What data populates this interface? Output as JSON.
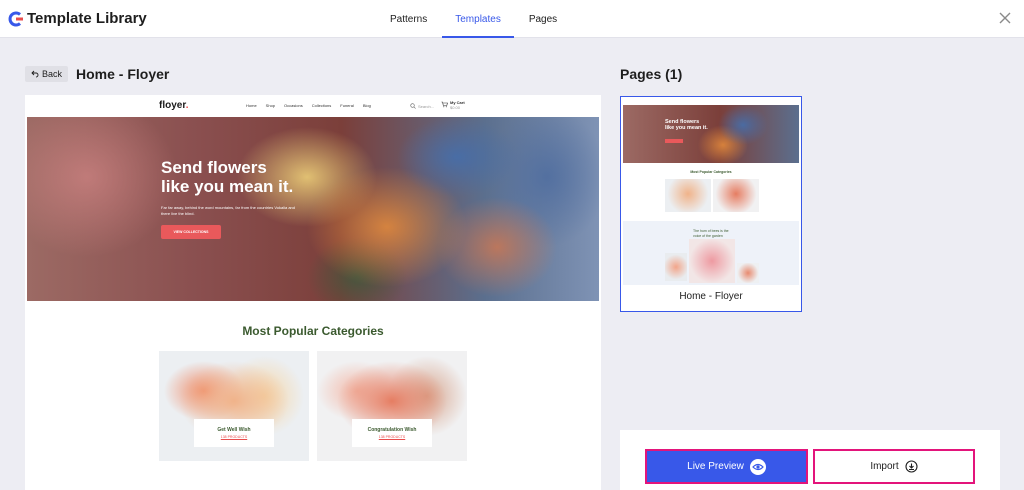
{
  "app": {
    "title": "Template Library"
  },
  "tabs": [
    {
      "label": "Patterns",
      "active": false
    },
    {
      "label": "Templates",
      "active": true
    },
    {
      "label": "Pages",
      "active": false
    }
  ],
  "header": {
    "back_label": "Back",
    "template_title": "Home - Floyer"
  },
  "preview": {
    "site_logo": "floyer",
    "site_logo_dot": ".",
    "menu": [
      "Home",
      "Shop",
      "Occasions",
      "Collections",
      "Funeral",
      "Blog"
    ],
    "search_placeholder": "Search...",
    "cart_label": "My Cart",
    "cart_amount": "$0.00",
    "hero_title_line1": "Send flowers",
    "hero_title_line2": "like you mean it.",
    "hero_text": "Far far away, behind the word mountains, far from the countries Vokalia and there live the blind.",
    "hero_button": "VIEW COLLECTIONS",
    "categories_title": "Most Popular Categories",
    "categories": [
      {
        "name": "Get Well Wish",
        "count": "138 PRODUCTS"
      },
      {
        "name": "Congratulation Wish",
        "count": "138 PRODUCTS"
      }
    ]
  },
  "pages_panel": {
    "title": "Pages (1)",
    "thumb": {
      "hero_line1": "Send flowers",
      "hero_line2": "like you mean it.",
      "categories_title": "Most Popular Categories",
      "section_line1": "The hum of bees is the",
      "section_line2": "voice of the garden",
      "caption": "Home - Floyer"
    }
  },
  "actions": {
    "live_preview_label": "Live Preview",
    "import_label": "Import"
  },
  "colors": {
    "accent": "#3858e9",
    "highlight_border": "#e3147b",
    "hero_button": "#e9595b",
    "category_title": "#3b5a2f"
  },
  "icons": {
    "close": "close-icon",
    "back": "back-arrow-icon",
    "eye": "eye-icon",
    "import": "download-icon",
    "search": "search-icon",
    "cart": "cart-icon"
  }
}
